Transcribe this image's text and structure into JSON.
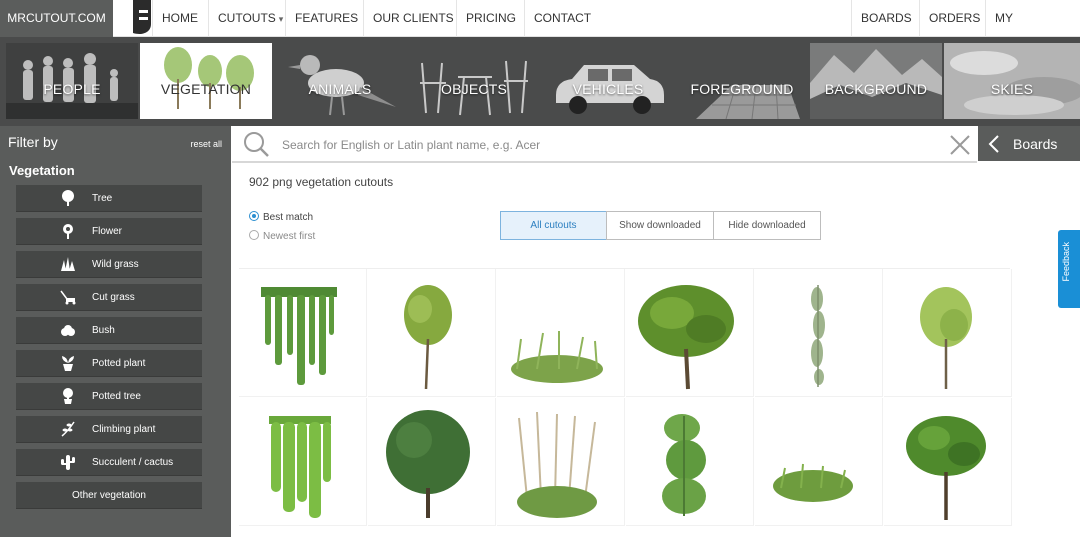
{
  "brand": {
    "name": "MRCUTOUT.COM"
  },
  "nav": {
    "left": [
      {
        "label": "HOME"
      },
      {
        "label": "CUTOUTS",
        "caret": "▾"
      },
      {
        "label": "FEATURES"
      },
      {
        "label": "OUR CLIENTS"
      },
      {
        "label": "PRICING"
      },
      {
        "label": "CONTACT"
      }
    ],
    "right": [
      {
        "label": "BOARDS"
      },
      {
        "label": "ORDERS"
      },
      {
        "label": "MY ACCOUNT",
        "caret": "▾"
      }
    ]
  },
  "categories": [
    {
      "label": "PEOPLE"
    },
    {
      "label": "VEGETATION",
      "active": true
    },
    {
      "label": "ANIMALS"
    },
    {
      "label": "OBJECTS"
    },
    {
      "label": "VEHICLES"
    },
    {
      "label": "FOREGROUND"
    },
    {
      "label": "BACKGROUND"
    },
    {
      "label": "SKIES"
    }
  ],
  "sidebar": {
    "filter_title": "Filter by",
    "reset_label": "reset all",
    "section_title": "Vegetation",
    "filters": [
      {
        "label": "Tree",
        "icon": "tree-icon"
      },
      {
        "label": "Flower",
        "icon": "flower-icon"
      },
      {
        "label": "Wild grass",
        "icon": "wild-grass-icon"
      },
      {
        "label": "Cut grass",
        "icon": "lawn-mower-icon"
      },
      {
        "label": "Bush",
        "icon": "bush-icon"
      },
      {
        "label": "Potted plant",
        "icon": "potted-plant-icon"
      },
      {
        "label": "Potted tree",
        "icon": "potted-tree-icon"
      },
      {
        "label": "Climbing plant",
        "icon": "climbing-plant-icon"
      },
      {
        "label": "Succulent / cactus",
        "icon": "cactus-icon"
      },
      {
        "label": "Other vegetation",
        "icon": ""
      }
    ]
  },
  "search": {
    "placeholder": "Search for English or Latin plant name, e.g. Acer"
  },
  "boards_label": "Boards",
  "results": {
    "count_text": "902 png vegetation cutouts",
    "sort_options": [
      {
        "label": "Best match",
        "selected": true
      },
      {
        "label": "Newest first",
        "selected": false
      }
    ],
    "download_filters": [
      {
        "label": "All cutouts",
        "active": true
      },
      {
        "label": "Show downloaded",
        "active": false
      },
      {
        "label": "Hide downloaded",
        "active": false
      }
    ]
  },
  "thumbnails": [
    {
      "kind": "hanging-ivy"
    },
    {
      "kind": "small-tree"
    },
    {
      "kind": "grass-clump"
    },
    {
      "kind": "round-tree"
    },
    {
      "kind": "thin-vine"
    },
    {
      "kind": "slender-tree"
    },
    {
      "kind": "ivy-curtain"
    },
    {
      "kind": "dark-tree"
    },
    {
      "kind": "pampas-grass"
    },
    {
      "kind": "climbing-ivy"
    },
    {
      "kind": "low-grass"
    },
    {
      "kind": "broad-tree"
    }
  ],
  "feedback": {
    "label": "Feedback"
  },
  "colors": {
    "sidebar_bg": "#5a5c5b",
    "filter_button_bg": "#454746",
    "category_strip_bg": "#4a4b4b",
    "accent_blue": "#2c8fd0",
    "feedback_bg": "#1a8fd6"
  }
}
